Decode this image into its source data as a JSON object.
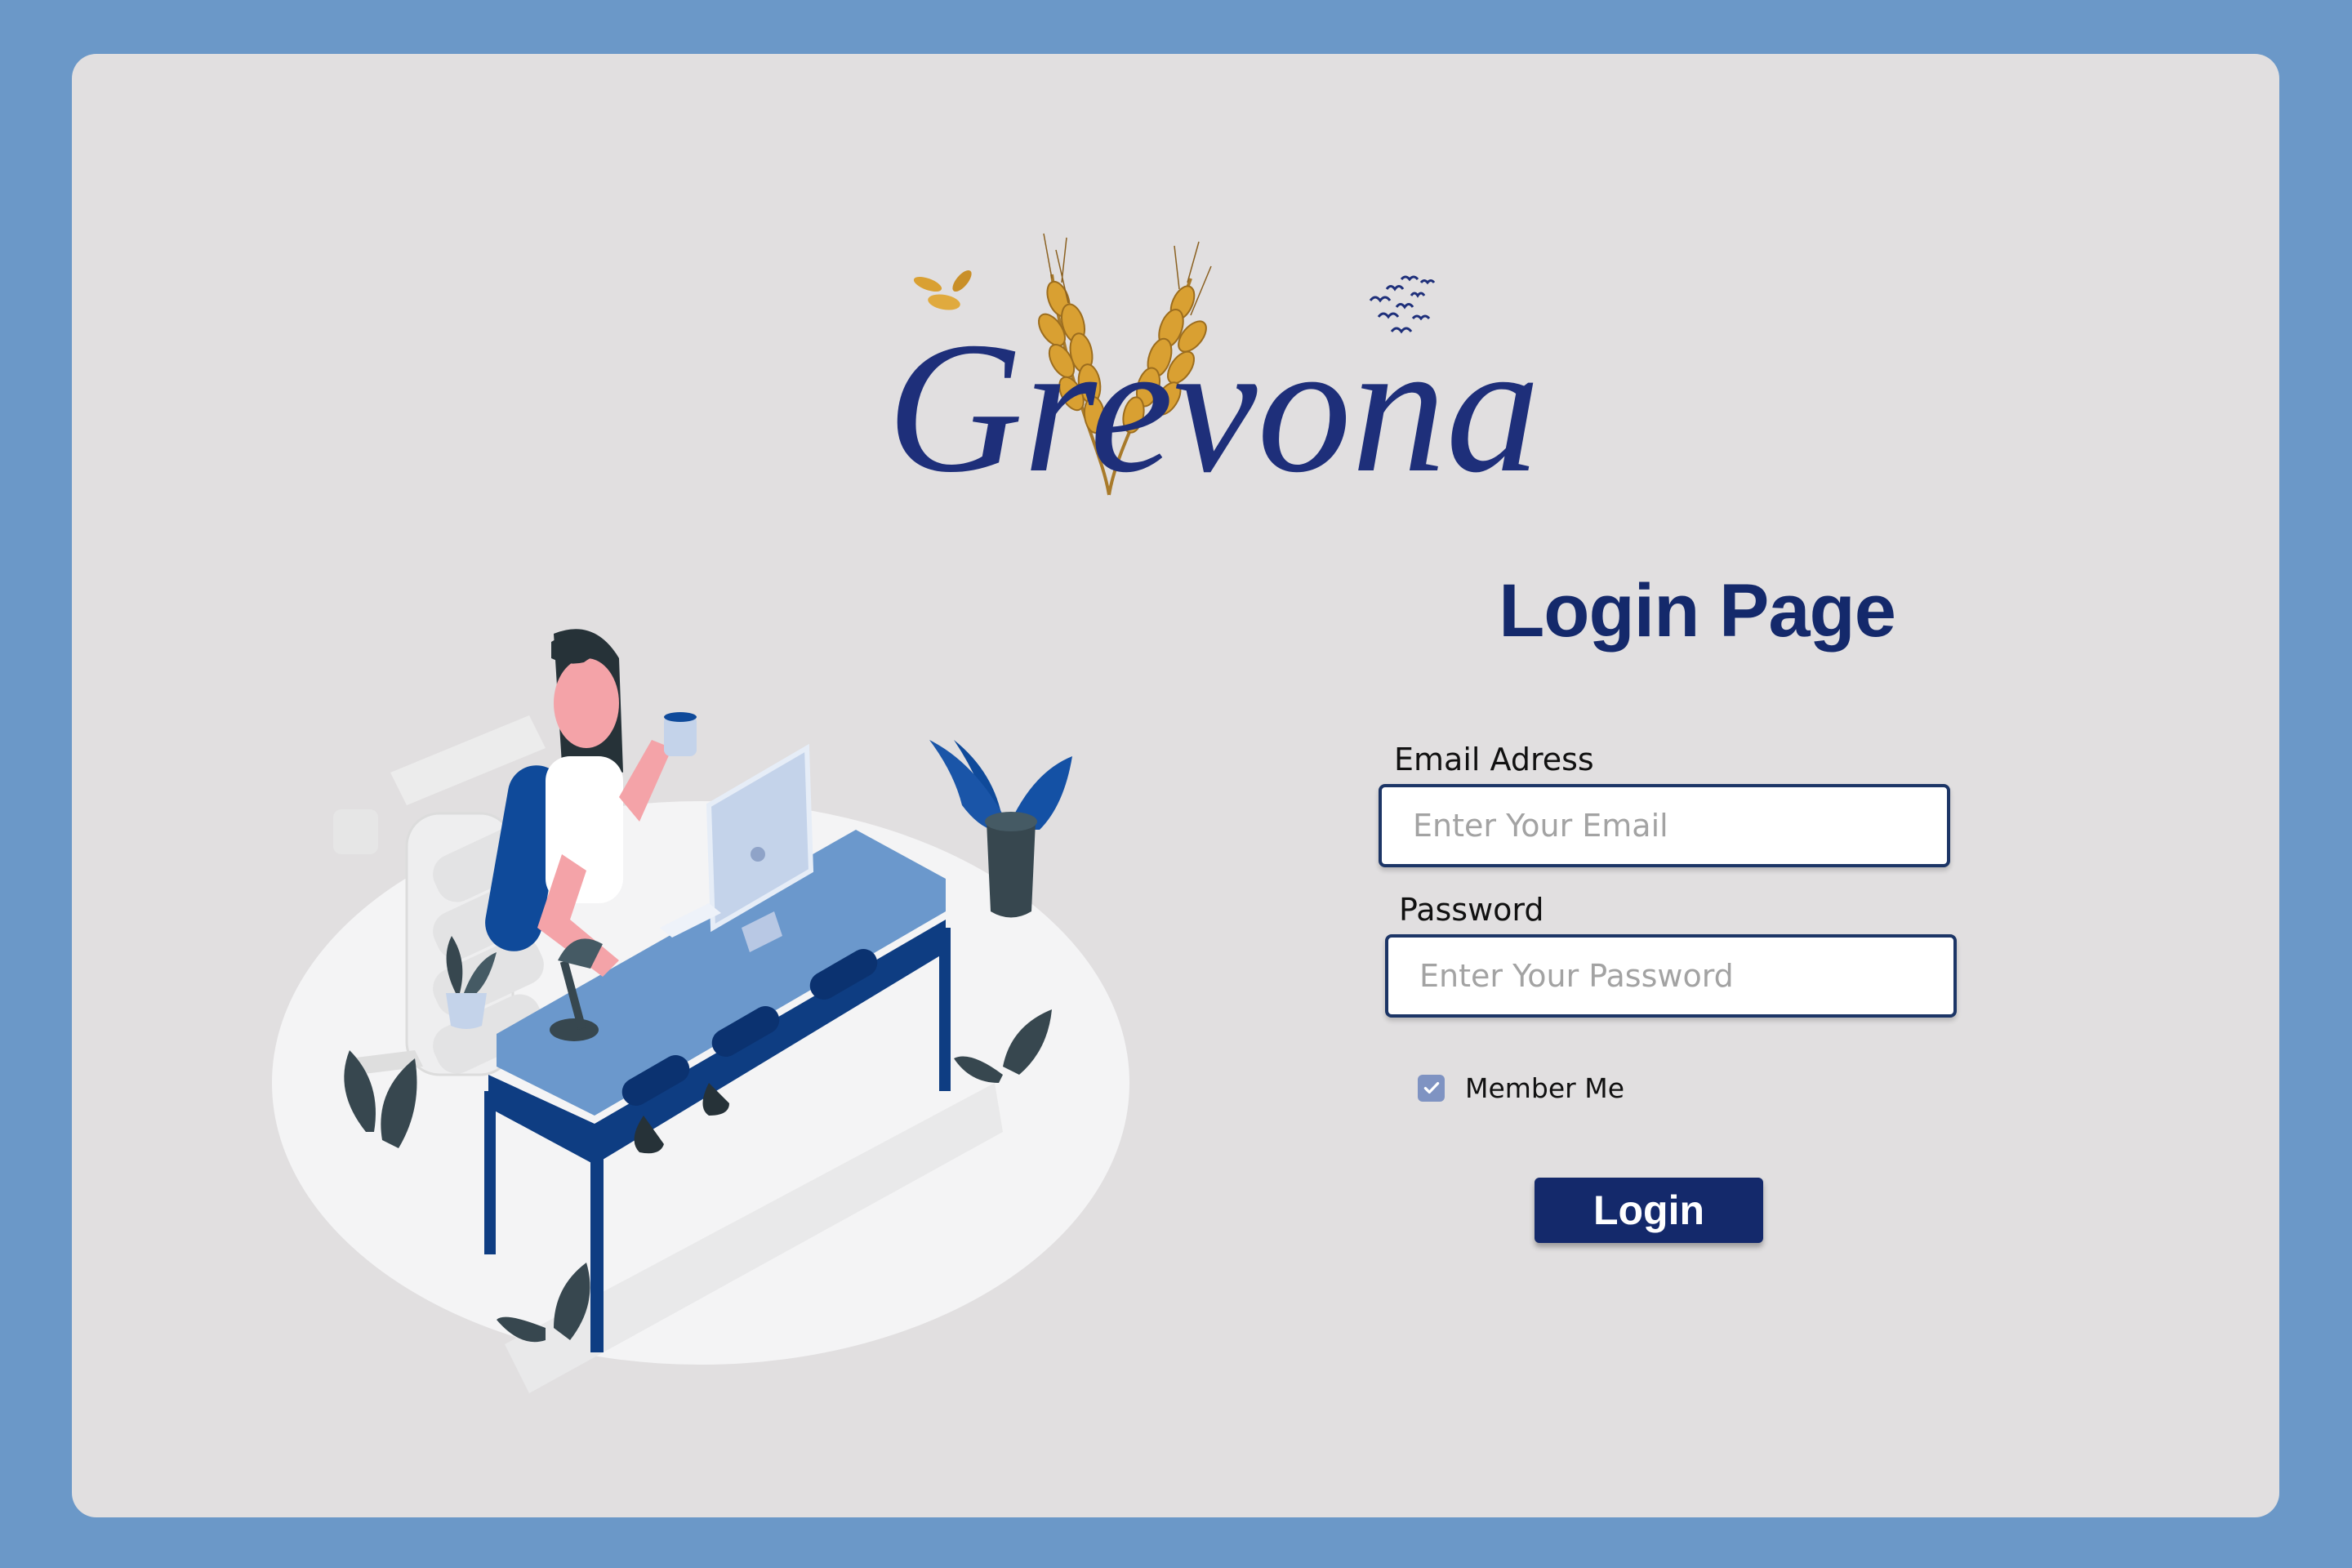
{
  "brand": {
    "logo_text": "Grevona",
    "text_color": "#1e2f7a",
    "accent_color": "#d9a032"
  },
  "page": {
    "title": "Login Page",
    "background_color": "#6b98c8",
    "card_color": "#e1dfe0"
  },
  "form": {
    "email": {
      "label": "Email Adress",
      "placeholder": "Enter Your Email",
      "value": ""
    },
    "password": {
      "label": "Password",
      "placeholder": "Enter Your Password",
      "value": ""
    },
    "remember": {
      "label": "Member Me",
      "checked": true
    },
    "submit_label": "Login",
    "primary_color": "#14296b"
  },
  "illustration": {
    "description_icon": "woman-at-desk-illustration"
  }
}
